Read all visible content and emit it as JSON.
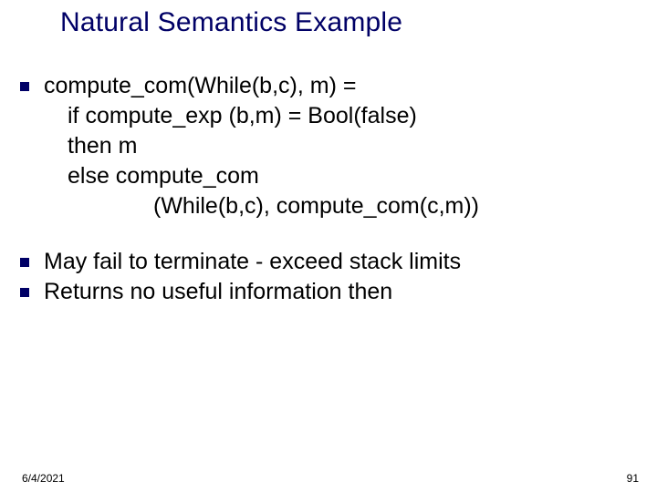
{
  "slide": {
    "title": "Natural Semantics Example",
    "bullets": [
      {
        "line1": "compute_com(While(b,c), m) =",
        "line2": "if compute_exp (b,m) = Bool(false)",
        "line3": "then m",
        "line4": "else compute_com",
        "line5": "(While(b,c), compute_com(c,m))"
      },
      {
        "text": "May fail to terminate - exceed stack limits"
      },
      {
        "text": "Returns no useful information then"
      }
    ]
  },
  "footer": {
    "date": "6/4/2021",
    "page": "91"
  }
}
